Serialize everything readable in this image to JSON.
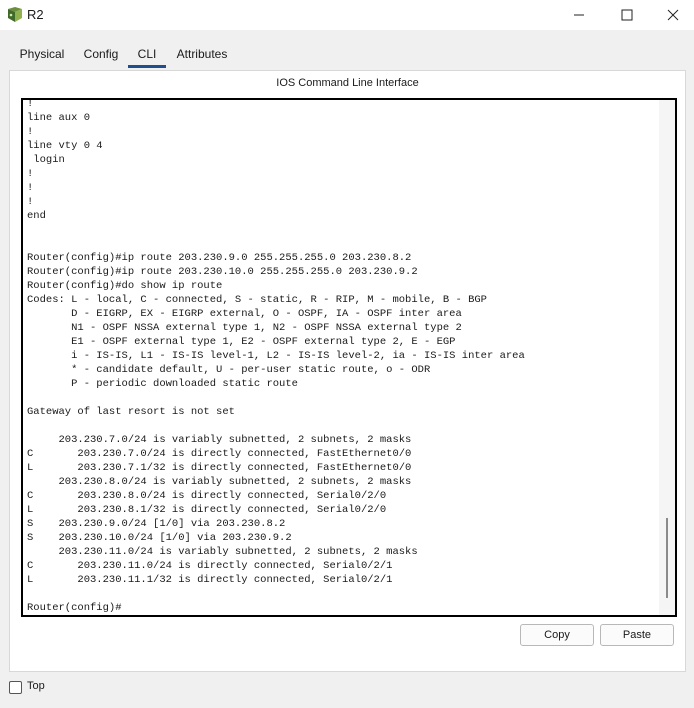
{
  "window": {
    "title": "R2",
    "app_icon": "router-icon",
    "controls": [
      "minimize-icon",
      "maximize-icon",
      "close-icon"
    ]
  },
  "tabs": [
    {
      "label": "Physical",
      "active": false
    },
    {
      "label": "Config",
      "active": false
    },
    {
      "label": "CLI",
      "active": true
    },
    {
      "label": "Attributes",
      "active": false
    }
  ],
  "cli": {
    "heading": "IOS Command Line Interface",
    "terminal_text": "!\nline aux 0\n!\nline vty 0 4\n login\n!\n!\n!\nend\n\n\nRouter(config)#ip route 203.230.9.0 255.255.255.0 203.230.8.2\nRouter(config)#ip route 203.230.10.0 255.255.255.0 203.230.9.2\nRouter(config)#do show ip route\nCodes: L - local, C - connected, S - static, R - RIP, M - mobile, B - BGP\n       D - EIGRP, EX - EIGRP external, O - OSPF, IA - OSPF inter area\n       N1 - OSPF NSSA external type 1, N2 - OSPF NSSA external type 2\n       E1 - OSPF external type 1, E2 - OSPF external type 2, E - EGP\n       i - IS-IS, L1 - IS-IS level-1, L2 - IS-IS level-2, ia - IS-IS inter area\n       * - candidate default, U - per-user static route, o - ODR\n       P - periodic downloaded static route\n\nGateway of last resort is not set\n\n     203.230.7.0/24 is variably subnetted, 2 subnets, 2 masks\nC       203.230.7.0/24 is directly connected, FastEthernet0/0\nL       203.230.7.1/32 is directly connected, FastEthernet0/0\n     203.230.8.0/24 is variably subnetted, 2 subnets, 2 masks\nC       203.230.8.0/24 is directly connected, Serial0/2/0\nL       203.230.8.1/32 is directly connected, Serial0/2/0\nS    203.230.9.0/24 [1/0] via 203.230.8.2\nS    203.230.10.0/24 [1/0] via 203.230.9.2\n     203.230.11.0/24 is variably subnetted, 2 subnets, 2 masks\nC       203.230.11.0/24 is directly connected, Serial0/2/1\nL       203.230.11.1/32 is directly connected, Serial0/2/1\n\nRouter(config)#",
    "copy_label": "Copy",
    "paste_label": "Paste"
  },
  "footer": {
    "top_label": "Top",
    "top_checked": false
  },
  "colors": {
    "active_tab_underline": "#1f4f8f",
    "terminal_border": "#000000"
  }
}
